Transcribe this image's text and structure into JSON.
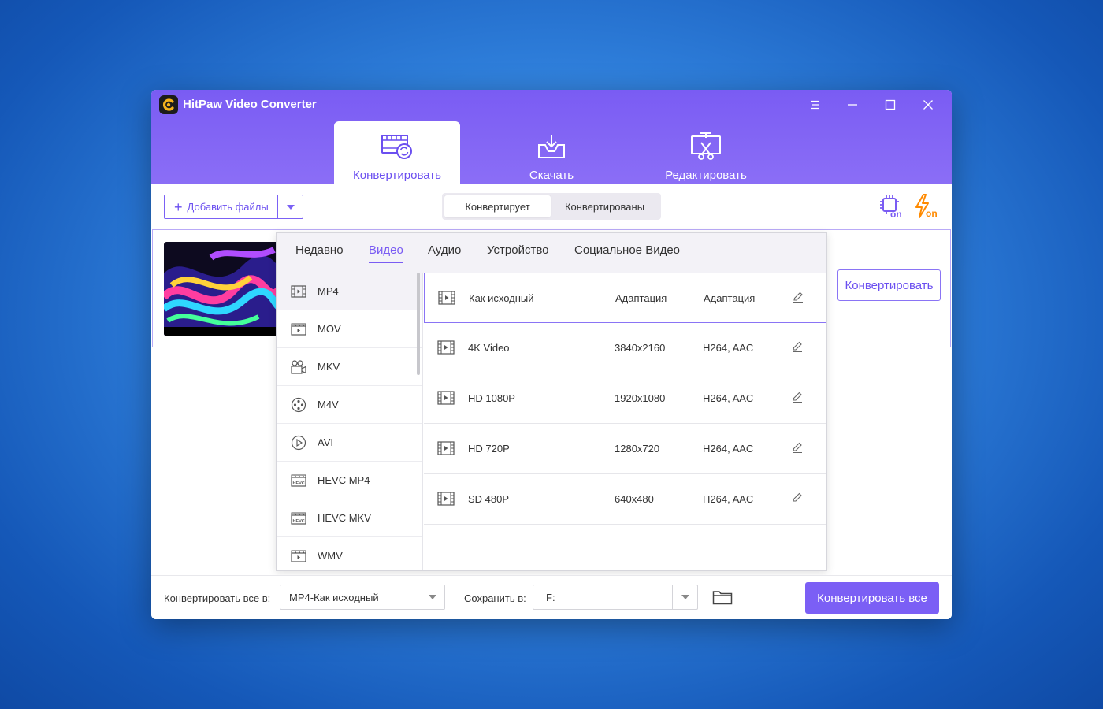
{
  "window": {
    "title": "HitPaw Video Converter"
  },
  "main_tabs": [
    {
      "label": "Конвертировать",
      "icon": "convert-film-icon",
      "active": true
    },
    {
      "label": "Скачать",
      "icon": "download-tray-icon",
      "active": false
    },
    {
      "label": "Редактировать",
      "icon": "edit-scissors-icon",
      "active": false
    }
  ],
  "toolbar": {
    "add_files_label": "Добавить файлы",
    "segments": [
      {
        "label": "Конвертирует",
        "active": true
      },
      {
        "label": "Конвертированы",
        "active": false
      }
    ],
    "hw_accel_icon": "cpu-on-icon",
    "lightning_icon": "lightning-on-icon",
    "hw_accel_badge": "on",
    "lightning_badge": "on"
  },
  "file_row": {
    "convert_label": "Конвертировать"
  },
  "format_panel": {
    "tabs": [
      {
        "label": "Недавно",
        "active": false
      },
      {
        "label": "Видео",
        "active": true
      },
      {
        "label": "Аудио",
        "active": false
      },
      {
        "label": "Устройство",
        "active": false
      },
      {
        "label": "Социальное Видео",
        "active": false
      }
    ],
    "formats": [
      {
        "label": "MP4",
        "icon": "film-icon",
        "selected": true
      },
      {
        "label": "MOV",
        "icon": "clapper-icon",
        "selected": false
      },
      {
        "label": "MKV",
        "icon": "camera-icon",
        "selected": false
      },
      {
        "label": "M4V",
        "icon": "reel-icon",
        "selected": false
      },
      {
        "label": "AVI",
        "icon": "play-circle-icon",
        "selected": false
      },
      {
        "label": "HEVC MP4",
        "icon": "hevc-icon",
        "selected": false
      },
      {
        "label": "HEVC MKV",
        "icon": "hevc-icon",
        "selected": false
      },
      {
        "label": "WMV",
        "icon": "clapper-icon",
        "selected": false
      }
    ],
    "hevc_badge": "HEVC",
    "presets": [
      {
        "name": "Как исходный",
        "resolution": "Адаптация",
        "codec": "Адаптация",
        "selected": true
      },
      {
        "name": "4K Video",
        "resolution": "3840x2160",
        "codec": "H264, AAC",
        "selected": false
      },
      {
        "name": "HD 1080P",
        "resolution": "1920x1080",
        "codec": "H264, AAC",
        "selected": false
      },
      {
        "name": "HD 720P",
        "resolution": "1280x720",
        "codec": "H264, AAC",
        "selected": false
      },
      {
        "name": "SD 480P",
        "resolution": "640x480",
        "codec": "H264, AAC",
        "selected": false
      }
    ]
  },
  "footer": {
    "convert_all_to_label": "Конвертировать все в:",
    "convert_all_to_value": "MP4-Как исходный",
    "save_to_label": "Сохранить в:",
    "save_to_value": "F:",
    "convert_all_button": "Конвертировать все"
  },
  "colors": {
    "accent": "#7b5ff5",
    "titlebar": "#8068f4",
    "desktop": "#2f7fdb"
  }
}
